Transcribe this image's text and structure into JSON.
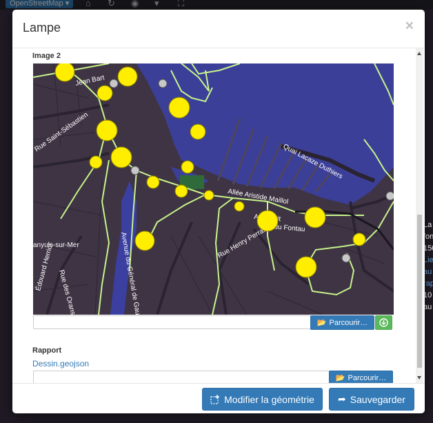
{
  "background": {
    "layer_select": "OpenStreetMap ▾",
    "side_text": [
      "La",
      "fon",
      "150",
      "Lie",
      "au",
      "rap",
      "10",
      "au"
    ]
  },
  "modal": {
    "title": "Lampe",
    "close": "×"
  },
  "image2": {
    "label": "Image 2",
    "browse_label": "Parcourir…"
  },
  "map": {
    "labels": {
      "jean_bart": "Jean Bart",
      "saint_sebastien": "Rue Saint-Sébastien",
      "quai": "Quai Lacaze Duthiers",
      "allee": "Allée Aristide Maillol",
      "pettit": "Av. Pettit",
      "fontau": "Av. du Fontau",
      "banyuls": "anyuls-sur-Mer",
      "henry_perrault": "Rue Henry Perrault",
      "general": "Avenue du Général de Gaulle",
      "herriot": "Édouard Herriot",
      "rue_des": "Rue des Orans"
    }
  },
  "rapport": {
    "label": "Rapport",
    "file_link": "Dessin.geojson",
    "browse_label": "Parcourir…"
  },
  "footer": {
    "modify_label": "Modifier la géométrie",
    "save_label": "Sauvegarder"
  },
  "colors": {
    "primary": "#337ab7",
    "success": "#5cb85c",
    "map_water": "#3b3f98",
    "map_land": "#3f3444",
    "map_path": "#c8f58c",
    "map_point": "#ffee00"
  }
}
